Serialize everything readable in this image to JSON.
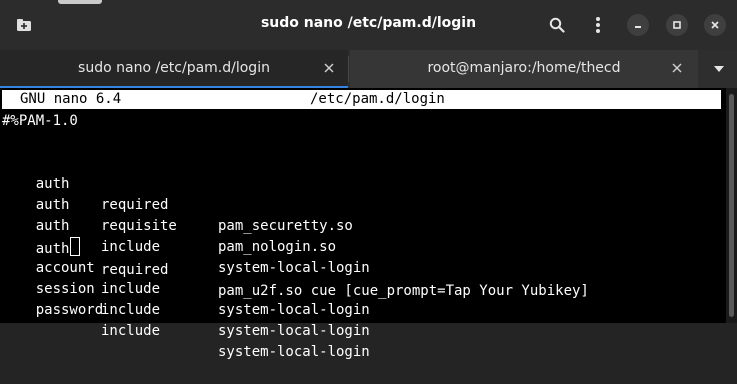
{
  "window": {
    "title": "sudo nano /etc/pam.d/login",
    "buttons": [
      "minimize",
      "maximize",
      "close"
    ]
  },
  "tabs": [
    {
      "label": "sudo nano /etc/pam.d/login",
      "active": true
    },
    {
      "label": "root@manjaro:/home/thecd",
      "active": false
    }
  ],
  "nano": {
    "version": "GNU nano 6.4",
    "filename": "/etc/pam.d/login"
  },
  "file": {
    "header": "#%PAM-1.0",
    "lines": [
      {
        "type": "auth",
        "control": "required",
        "module": "pam_securetty.so"
      },
      {
        "type": "auth",
        "control": "requisite",
        "module": "pam_nologin.so"
      },
      {
        "type": "auth",
        "control": "include",
        "module": "system-local-login"
      },
      {
        "type": "auth",
        "control": "required",
        "module": "pam_u2f.so cue [cue_prompt=Tap Your Yubikey]"
      },
      {
        "type": "account",
        "control": "include",
        "module": "system-local-login"
      },
      {
        "type": "session",
        "control": "include",
        "module": "system-local-login"
      },
      {
        "type": "password",
        "control": "include",
        "module": "system-local-login"
      }
    ]
  },
  "colors": {
    "accent": "#3584e4",
    "terminal_bg": "#000000",
    "terminal_fg": "#ffffff"
  },
  "icons": [
    "new-tab-icon",
    "search-icon",
    "kebab-menu-icon",
    "minimize-icon",
    "maximize-icon",
    "close-icon",
    "tab-close-icon",
    "dropdown-icon"
  ]
}
